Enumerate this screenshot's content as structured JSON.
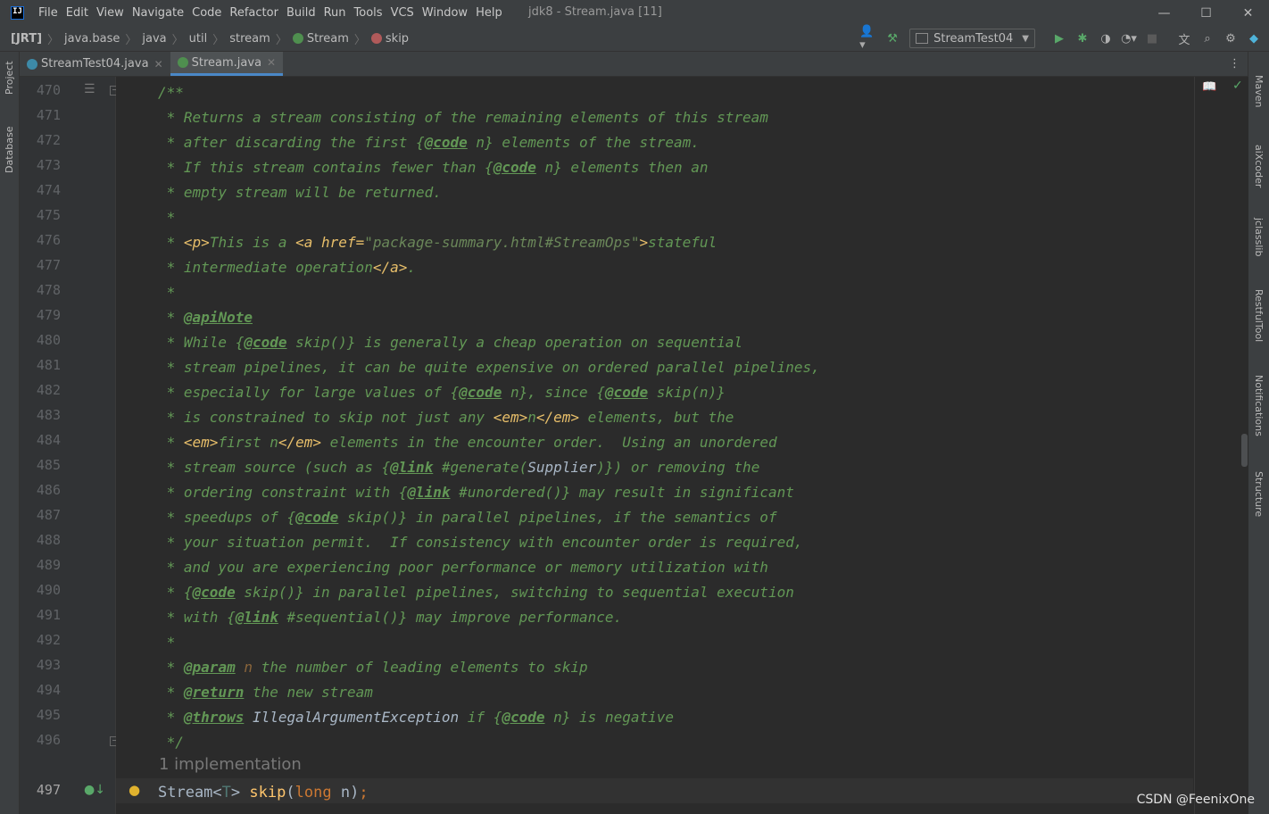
{
  "window": {
    "app_icon": "IJ",
    "title": "jdk8 - Stream.java [11]",
    "controls": [
      "—",
      "☐",
      "✕"
    ]
  },
  "menu": [
    "File",
    "Edit",
    "View",
    "Navigate",
    "Code",
    "Refactor",
    "Build",
    "Run",
    "Tools",
    "VCS",
    "Window",
    "Help"
  ],
  "breadcrumb": [
    "[JRT]",
    "java.base",
    "java",
    "util",
    "stream",
    "Stream",
    "skip"
  ],
  "run_config": "StreamTest04",
  "tabs": [
    {
      "label": "StreamTest04.java",
      "active": false,
      "icon": "class-icon"
    },
    {
      "label": "Stream.java",
      "active": true,
      "icon": "interface-icon"
    }
  ],
  "left_tools": [
    "Project",
    "Database"
  ],
  "right_tools": [
    "Maven",
    "aiXcoder",
    "jclasslib",
    "RestfulTool",
    "Notifications",
    "Structure"
  ],
  "colors": {
    "background": "#2b2b2b",
    "doc_comment": "#629755",
    "keyword": "#cc7832",
    "method": "#ffc66d",
    "active_tab": "#4a88c7"
  },
  "editor": {
    "line_numbers": [
      "470",
      "471",
      "472",
      "473",
      "474",
      "475",
      "476",
      "477",
      "478",
      "479",
      "480",
      "481",
      "482",
      "483",
      "484",
      "485",
      "486",
      "487",
      "488",
      "489",
      "490",
      "491",
      "492",
      "493",
      "494",
      "495",
      "496",
      "497"
    ],
    "implementation_hint": "1 implementation",
    "signature": {
      "type": "Stream",
      "type_param": "T",
      "method": "skip",
      "param_type": "long",
      "param": "n"
    }
  },
  "doc": {
    "l470": "/**",
    "l471": " * Returns a stream consisting of the remaining elements of this stream",
    "l472a": " * after discarding the first {",
    "l472b": "@code",
    "l472c": " n} elements of the stream.",
    "l473a": " * If this stream contains fewer than {",
    "l473b": "@code",
    "l473c": " n} elements then an",
    "l474": " * empty stream will be returned.",
    "l475": " *",
    "l476a": " * ",
    "l476b": "<p>",
    "l476c": "This is a ",
    "l476d": "<a href=",
    "l476e": "\"package-summary.html#StreamOps\"",
    "l476f": ">",
    "l476g": "stateful",
    "l477a": " * intermediate operation",
    "l477b": "</a>",
    "l477c": ".",
    "l478": " *",
    "l479a": " * ",
    "l479b": "@apiNote",
    "l480a": " * While {",
    "l480b": "@code",
    "l480c": " skip()} is generally a cheap operation on sequential",
    "l481": " * stream pipelines, it can be quite expensive on ordered parallel pipelines,",
    "l482a": " * especially for large values of {",
    "l482b": "@code",
    "l482c": " n}, since {",
    "l482d": "@code",
    "l482e": " skip(n)}",
    "l483a": " * is constrained to skip not just any ",
    "l483b": "<em>",
    "l483c": "n",
    "l483d": "</em>",
    "l483e": " elements, but the",
    "l484a": " * ",
    "l484b": "<em>",
    "l484c": "first n",
    "l484d": "</em>",
    "l484e": " elements in the encounter order.  Using an unordered",
    "l485a": " * stream source (such as {",
    "l485b": "@link",
    "l485c": " #generate(",
    "l485d": "Supplier",
    "l485e": ")}) or removing the",
    "l486a": " * ordering constraint with {",
    "l486b": "@link",
    "l486c": " #unordered()} may result in significant",
    "l487a": " * speedups of {",
    "l487b": "@code",
    "l487c": " skip()} in parallel pipelines, if the semantics of",
    "l488": " * your situation permit.  If consistency with encounter order is required,",
    "l489": " * and you are experiencing poor performance or memory utilization with",
    "l490a": " * {",
    "l490b": "@code",
    "l490c": " skip()} in parallel pipelines, switching to sequential execution",
    "l491a": " * with {",
    "l491b": "@link",
    "l491c": " #sequential()} may improve performance.",
    "l492": " *",
    "l493a": " * ",
    "l493b": "@param",
    "l493c": " n",
    "l493d": " the number of leading elements to skip",
    "l494a": " * ",
    "l494b": "@return",
    "l494c": " the new stream",
    "l495a": " * ",
    "l495b": "@throws",
    "l495c": " IllegalArgumentException",
    "l495d": " if {",
    "l495e": "@code",
    "l495f": " n} is negative",
    "l496": " */"
  },
  "watermark": "CSDN @FeenixOne"
}
